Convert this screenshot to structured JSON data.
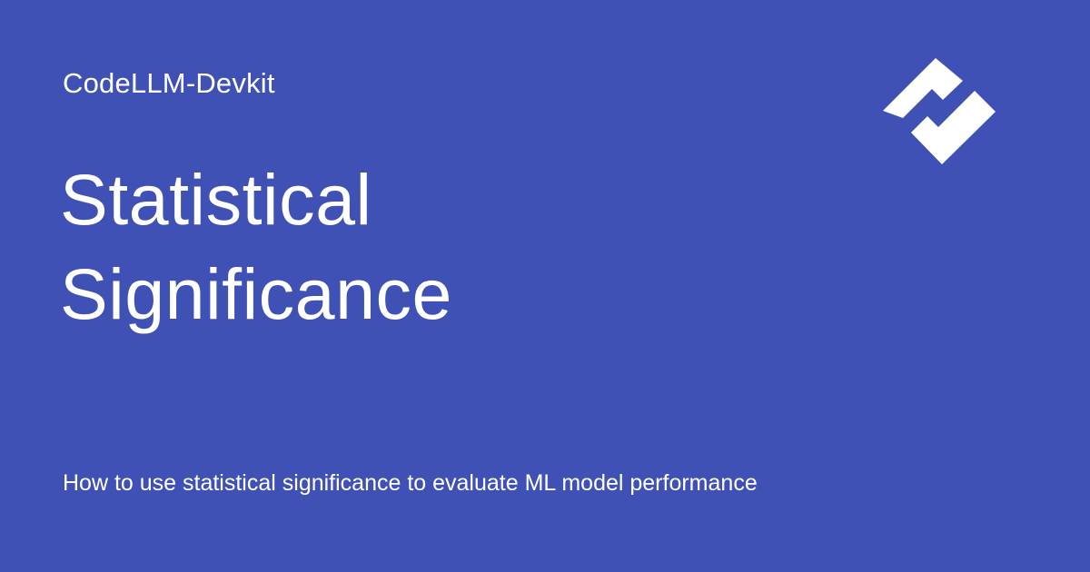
{
  "brand": {
    "site_name": "CodeLLM-Devkit",
    "logo_icon": "check-chevron-logo-icon"
  },
  "page": {
    "title_lines": [
      "Statistical",
      "Significance"
    ],
    "description": "How to use statistical significance to evaluate ML model performance"
  },
  "colors": {
    "background": "#3F51B5",
    "foreground": "#FFFFFF"
  }
}
